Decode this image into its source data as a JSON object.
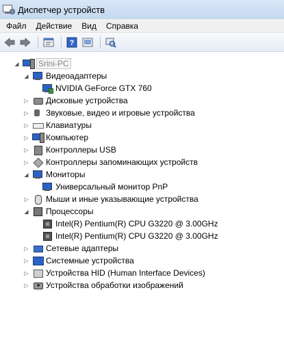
{
  "window": {
    "title": "Диспетчер устройств"
  },
  "menu": [
    "Файл",
    "Действие",
    "Вид",
    "Справка"
  ],
  "toolbar": {
    "icons": [
      "back-arrow-icon",
      "forward-arrow-icon",
      "properties-icon",
      "help-icon",
      "display-icon",
      "scan-hardware-icon"
    ]
  },
  "tree": {
    "root": "Srini-PC",
    "video": "Видеоадаптеры",
    "video_child": "NVIDIA GeForce GTX 760",
    "disks": "Дисковые устройства",
    "sound": "Звуковые, видео и игровые устройства",
    "keyboards": "Клавиатуры",
    "computer": "Компьютер",
    "usb": "Контроллеры USB",
    "storage": "Контроллеры запоминающих устройств",
    "monitors": "Мониторы",
    "monitor_child": "Универсальный монитор PnP",
    "mice": "Мыши и иные указывающие устройства",
    "cpus": "Процессоры",
    "cpu_child_1": "Intel(R) Pentium(R) CPU G3220 @ 3.00GHz",
    "cpu_child_2": "Intel(R) Pentium(R) CPU G3220 @ 3.00GHz",
    "net": "Сетевые адаптеры",
    "system": "Системные устройства",
    "hid": "Устройства HID (Human Interface Devices)",
    "imaging": "Устройства обработки изображений"
  }
}
